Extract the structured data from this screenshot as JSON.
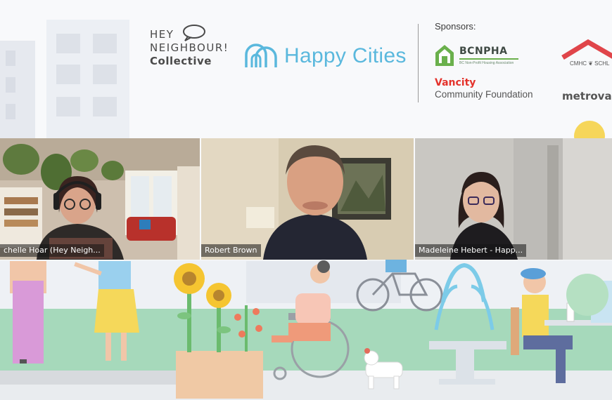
{
  "banner": {
    "hey_neighbour": {
      "line1": "HEY",
      "line2": "NEIGHBOUR!",
      "line3": "Collective"
    },
    "happy_cities": "Happy Cities",
    "sponsors_label": "Sponsors:",
    "bcnpha": {
      "name": "BCNPHA",
      "subtitle": "BC Non-Profit Housing Association"
    },
    "vancity": {
      "name": "Vancity",
      "subtitle": "Community Foundation"
    },
    "cmhc": "CMHC ❦ SCHL",
    "metro": "metrovancouver"
  },
  "participants": [
    {
      "name": "Michelle Hoar (Hey Neigh...",
      "display": "chelle Hoar (Hey Neigh..."
    },
    {
      "name": "Robert Brown",
      "display": "Robert Brown"
    },
    {
      "name": "Madeleine Hebert - Happ...",
      "display": "Madeleine Hebert - Happ..."
    }
  ],
  "colors": {
    "happy_blue": "#5ab8dd",
    "vancity_red": "#e4322b",
    "bcnpha_green": "#6ab04c",
    "cmhc_red": "#e0454a",
    "ground_green": "#9fd4b6"
  }
}
